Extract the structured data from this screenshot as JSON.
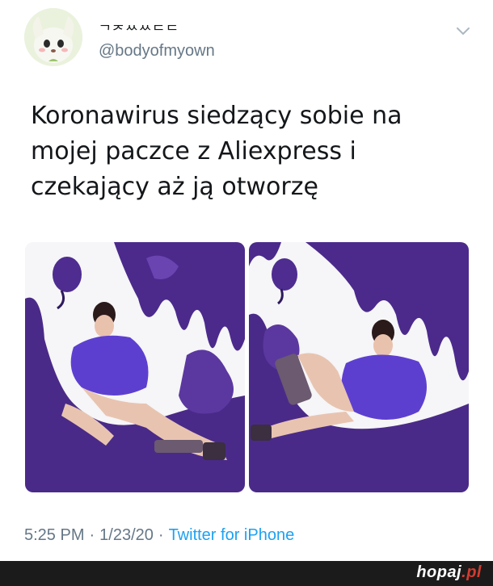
{
  "tweet": {
    "display_name": "ᄀᅎᄊᄊᄃᄃ",
    "handle": "@bodyofmyown",
    "text_lines": [
      "Koronawirus siedzący sobie na",
      "mojej paczce z Aliexpress i",
      "czekający aż ją otworzę"
    ],
    "time": "5:25 PM",
    "date": "1/23/20",
    "separator": "·",
    "source": "Twitter for iPhone",
    "menu_icon": "chevron-down-icon"
  },
  "photos": [
    {
      "name": "photo-left",
      "description_icon": "image"
    },
    {
      "name": "photo-right",
      "description_icon": "image"
    }
  ],
  "footer": {
    "brand_name": "hopaj",
    "brand_tld": ".pl",
    "brand_tld_color": "#d33b2f"
  },
  "colors": {
    "text": "#14171a",
    "secondary": "#657786",
    "link": "#1da1f2",
    "accent_purple": "#4b2a8c"
  }
}
